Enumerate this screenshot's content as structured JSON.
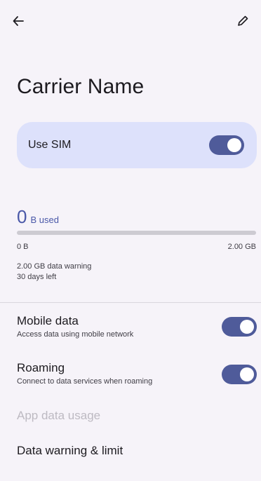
{
  "topbar": {
    "back_icon": "arrow-left-icon",
    "edit_icon": "pencil-icon"
  },
  "page": {
    "title": "Carrier Name"
  },
  "use_sim": {
    "label": "Use SIM",
    "enabled": true
  },
  "usage": {
    "amount": "0",
    "unit_label": "B used",
    "progress_fraction": 0,
    "min_label": "0 B",
    "max_label": "2.00 GB",
    "warning_text": "2.00 GB data warning",
    "days_left": "30 days left"
  },
  "settings": {
    "mobile_data": {
      "title": "Mobile data",
      "subtitle": "Access data using mobile network",
      "enabled": true
    },
    "roaming": {
      "title": "Roaming",
      "subtitle": "Connect to data services when roaming",
      "enabled": true
    },
    "app_data_usage": {
      "title": "App data usage"
    },
    "data_warning_limit": {
      "title": "Data warning & limit"
    }
  },
  "colors": {
    "background": "#f6f3f9",
    "accent": "#4f5b9a",
    "card": "#dde1fb",
    "usage_text": "#4a58a8"
  }
}
